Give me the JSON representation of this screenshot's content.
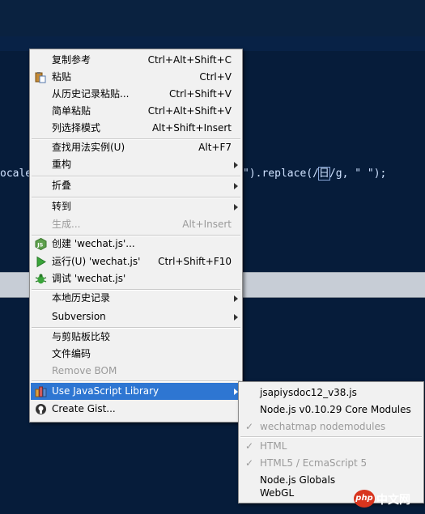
{
  "editor": {
    "code_left": "ocale",
    "code_right_pre": "\").replace(/",
    "code_right_hl": "日",
    "code_right_post": "/g, \" \");"
  },
  "context_menu": {
    "items": [
      {
        "label": "复制参考",
        "shortcut": "Ctrl+Alt+Shift+C"
      },
      {
        "label": "粘贴",
        "shortcut": "Ctrl+V"
      },
      {
        "label": "从历史记录粘贴...",
        "shortcut": "Ctrl+Shift+V"
      },
      {
        "label": "简单粘贴",
        "shortcut": "Ctrl+Alt+Shift+V"
      },
      {
        "label": "列选择模式",
        "shortcut": "Alt+Shift+Insert"
      },
      {
        "label": "查找用法实例(U)",
        "shortcut": "Alt+F7"
      },
      {
        "label": "重构",
        "shortcut": ""
      },
      {
        "label": "折叠",
        "shortcut": ""
      },
      {
        "label": "转到",
        "shortcut": ""
      },
      {
        "label": "生成...",
        "shortcut": "Alt+Insert"
      },
      {
        "label": "创建 'wechat.js'...",
        "shortcut": ""
      },
      {
        "label": "运行(U) 'wechat.js'",
        "shortcut": "Ctrl+Shift+F10"
      },
      {
        "label": "调试 'wechat.js'",
        "shortcut": ""
      },
      {
        "label": "本地历史记录",
        "shortcut": ""
      },
      {
        "label": "Subversion",
        "shortcut": ""
      },
      {
        "label": "与剪贴板比较",
        "shortcut": ""
      },
      {
        "label": "文件编码",
        "shortcut": ""
      },
      {
        "label": "Remove BOM",
        "shortcut": ""
      },
      {
        "label": "Use JavaScript Library",
        "shortcut": ""
      },
      {
        "label": "Create Gist...",
        "shortcut": ""
      }
    ]
  },
  "submenu": {
    "items": [
      {
        "label": "jsapiysdoc12_v38.js"
      },
      {
        "label": "Node.js v0.10.29 Core Modules"
      },
      {
        "label": "wechatmap nodemodules",
        "check": "✓"
      },
      {
        "label": "HTML",
        "check": "✓"
      },
      {
        "label": "HTML5 / EcmaScript 5",
        "check": "✓"
      },
      {
        "label": "Node.js Globals"
      },
      {
        "label": "WebGL"
      }
    ]
  },
  "watermark": {
    "badge": "php",
    "text": "中文网"
  },
  "colors": {
    "selection": "#2e76d2",
    "editor_bg": "#061c3a",
    "menu_bg": "#f1f1f1"
  }
}
